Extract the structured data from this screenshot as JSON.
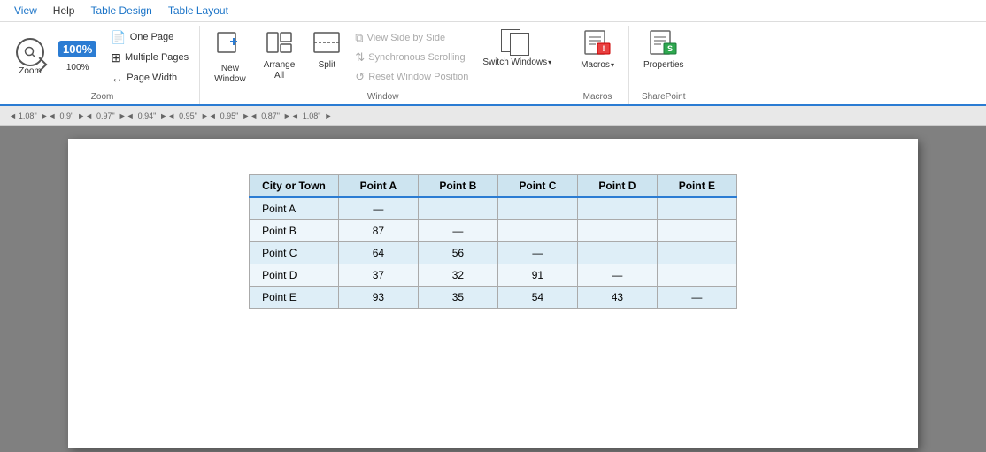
{
  "menubar": {
    "items": [
      {
        "label": "View",
        "active": true
      },
      {
        "label": "Help",
        "active": false
      },
      {
        "label": "Table Design",
        "active": false,
        "blue": true
      },
      {
        "label": "Table Layout",
        "active": false,
        "blue": true
      }
    ]
  },
  "ribbon": {
    "zoom_group": {
      "label": "Zoom",
      "zoom_label": "Zoom",
      "zoom_100_label": "100%",
      "one_page_label": "One Page",
      "multiple_pages_label": "Multiple Pages",
      "page_width_label": "Page Width"
    },
    "window_group": {
      "label": "Window",
      "new_window_label": "New\nWindow",
      "arrange_all_label": "Arrange\nAll",
      "split_label": "Split",
      "view_side_label": "View Side by Side",
      "sync_scroll_label": "Synchronous Scrolling",
      "reset_window_label": "Reset Window Position",
      "switch_windows_label": "Switch\nWindows"
    },
    "macros_group": {
      "label": "Macros",
      "macros_label": "Macros"
    },
    "sharepoint_group": {
      "label": "SharePoint",
      "properties_label": "Properties"
    }
  },
  "ruler": {
    "measurements": [
      "1.08\"",
      "0.9\"",
      "0.97\"",
      "0.94\"",
      "0.95\"",
      "0.95\"",
      "0.87\"",
      "1.08\""
    ]
  },
  "table": {
    "headers": [
      "City or Town",
      "Point A",
      "Point B",
      "Point C",
      "Point D",
      "Point E"
    ],
    "rows": [
      {
        "cells": [
          "Point A",
          "—",
          "",
          "",
          "",
          ""
        ]
      },
      {
        "cells": [
          "Point B",
          "87",
          "—",
          "",
          "",
          ""
        ]
      },
      {
        "cells": [
          "Point C",
          "64",
          "56",
          "—",
          "",
          ""
        ]
      },
      {
        "cells": [
          "Point D",
          "37",
          "32",
          "91",
          "—",
          ""
        ]
      },
      {
        "cells": [
          "Point E",
          "93",
          "35",
          "54",
          "43",
          "—"
        ]
      }
    ]
  }
}
